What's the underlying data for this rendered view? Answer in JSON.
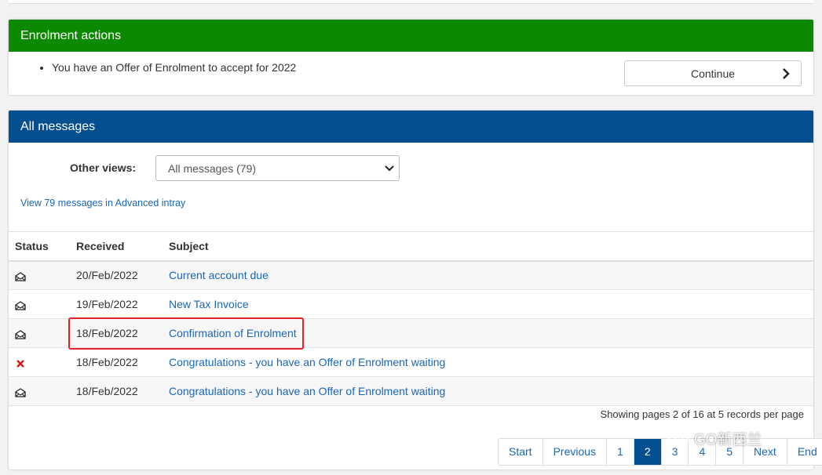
{
  "enrolment": {
    "title": "Enrolment actions",
    "items": [
      "You have an Offer of Enrolment to accept for 2022"
    ],
    "continue_label": "Continue"
  },
  "messages": {
    "title": "All messages",
    "views_label": "Other views:",
    "views_value": "All messages (79)",
    "advanced_link": "View 79 messages in Advanced intray",
    "columns": [
      "Status",
      "Received",
      "Subject"
    ],
    "rows": [
      {
        "status_icon": "envelope-icon",
        "received": "20/Feb/2022",
        "subject": "Current account due"
      },
      {
        "status_icon": "envelope-icon",
        "received": "19/Feb/2022",
        "subject": "New Tax Invoice"
      },
      {
        "status_icon": "envelope-icon",
        "received": "18/Feb/2022",
        "subject": "Confirmation of Enrolment"
      },
      {
        "status_icon": "red-cross-icon",
        "received": "18/Feb/2022",
        "subject": "Congratulations - you have an Offer of Enrolment waiting"
      },
      {
        "status_icon": "envelope-icon",
        "received": "18/Feb/2022",
        "subject": "Congratulations - you have an Offer of Enrolment waiting"
      }
    ],
    "paging_info": "Showing pages 2 of 16 at 5 records per page",
    "pagination": [
      "Start",
      "Previous",
      "1",
      "2",
      "3",
      "4",
      "5",
      "Next",
      "End"
    ],
    "active_page": "2"
  },
  "watermark": "GO新西兰",
  "colors": {
    "enrol_header": "#0b8a00",
    "messages_header": "#034f8f",
    "link": "#1a66b5",
    "highlight": "#e6232b"
  }
}
